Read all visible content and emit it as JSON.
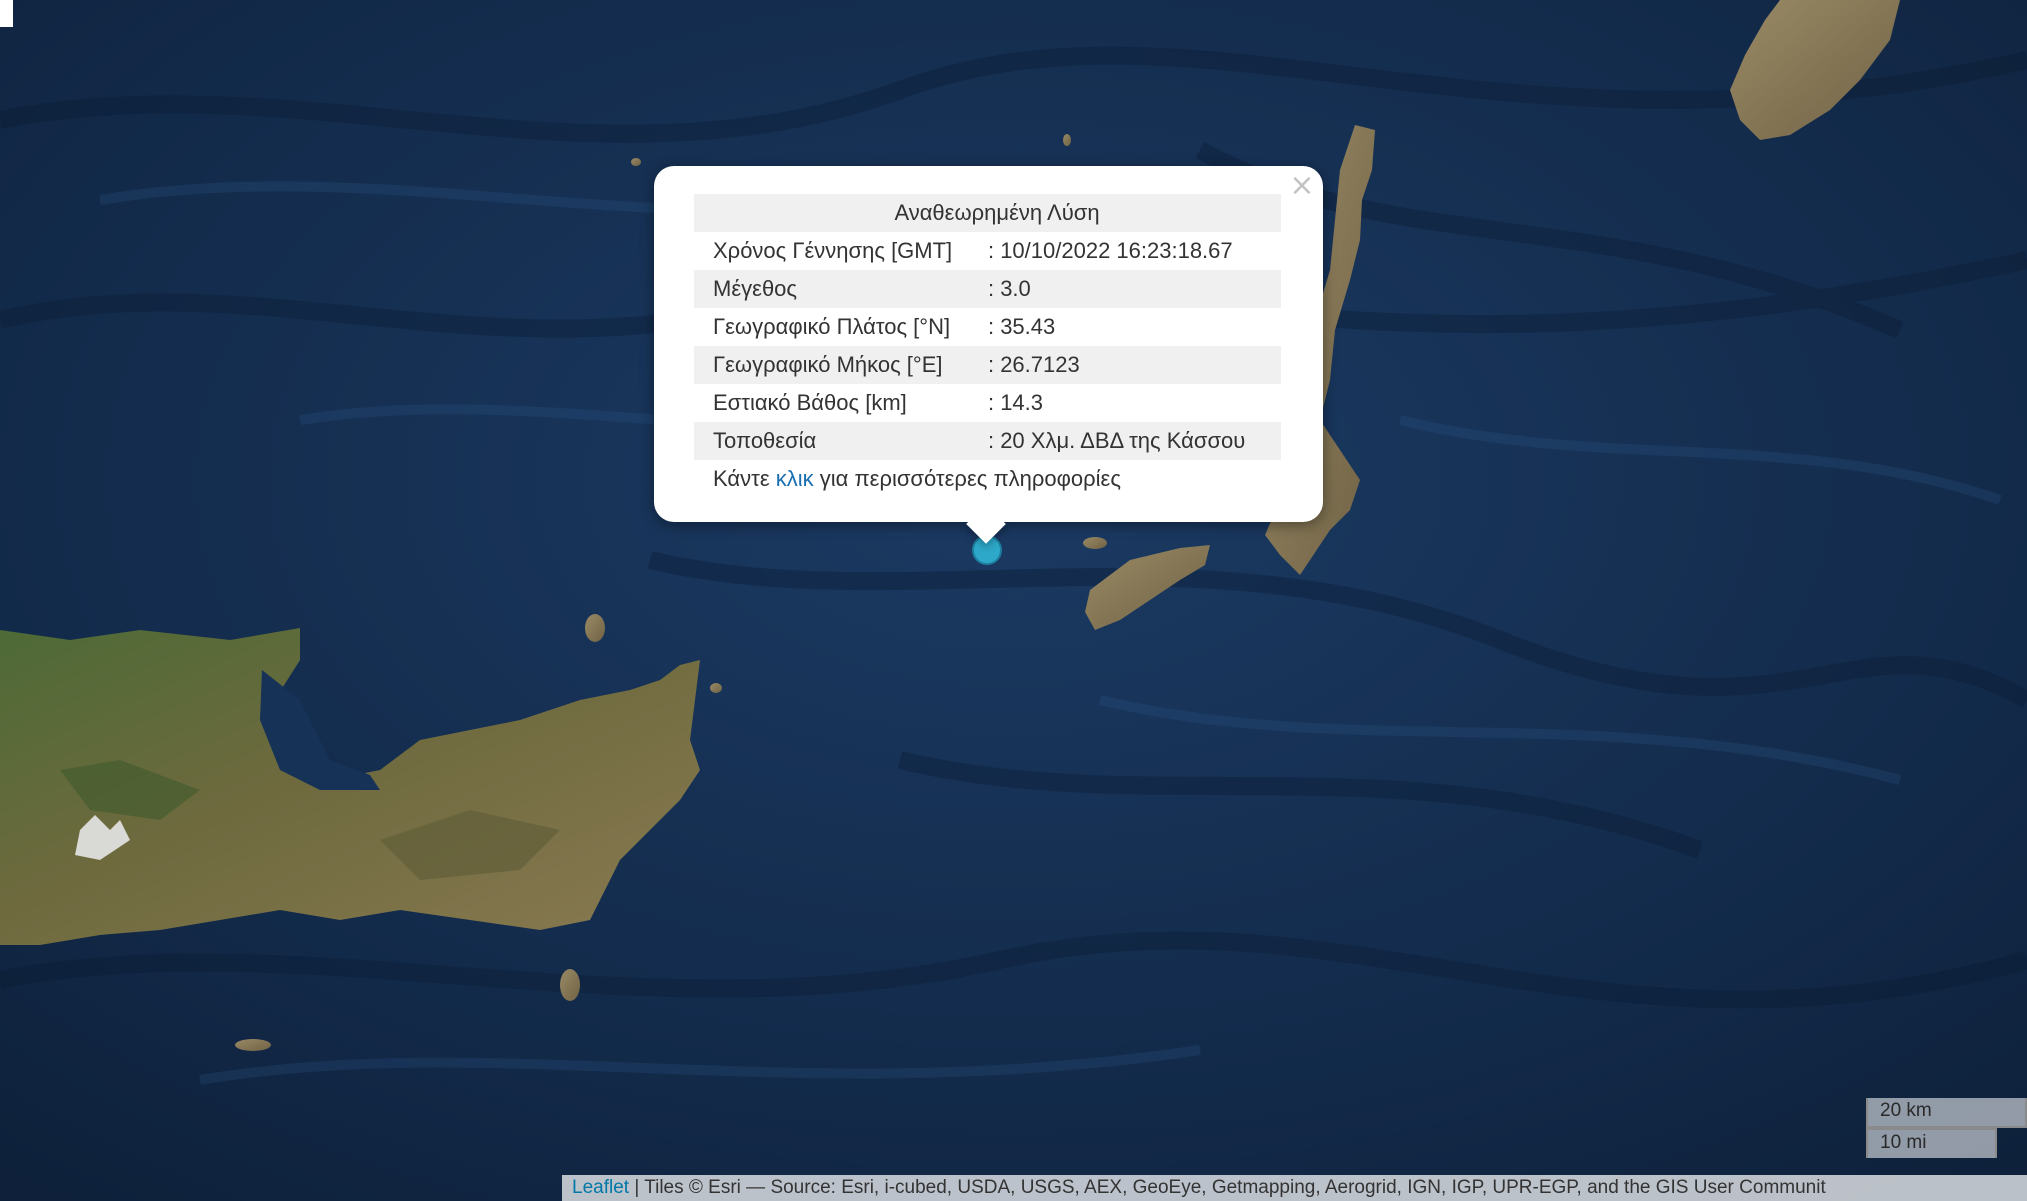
{
  "popup": {
    "title": "Αναθεωρημένη Λύση",
    "close_symbol": "×",
    "rows": [
      {
        "label": "Χρόνος Γέννησης [GMT]",
        "value": ": 10/10/2022 16:23:18.67"
      },
      {
        "label": "Μέγεθος",
        "value": ": 3.0"
      },
      {
        "label": "Γεωγραφικό Πλάτος [°N]",
        "value": ": 35.43"
      },
      {
        "label": "Γεωγραφικό Μήκος [°E]",
        "value": ": 26.7123"
      },
      {
        "label": "Εστιακό Βάθος [km]",
        "value": ": 14.3"
      },
      {
        "label": "Τοποθεσία",
        "value": ": 20 Χλμ. ΔΒΔ της Κάσσου"
      }
    ],
    "footer": {
      "prefix": "Κάντε ",
      "link": "κλικ",
      "suffix": " για περισσότερες πληροφορίες"
    }
  },
  "marker": {
    "name": "earthquake-epicenter",
    "color": "#2ea8c9"
  },
  "scale": {
    "km_label": "20 km",
    "mi_label": "10 mi"
  },
  "attribution": {
    "link": "Leaflet",
    "text": " | Tiles © Esri — Source: Esri, i-cubed, USDA, USGS, AEX, GeoEye, Getmapping, Aerogrid, IGN, IGP, UPR-EGP, and the GIS User Communit"
  },
  "colors": {
    "sea": "#12294a",
    "land": "#5e6b3a",
    "popup_title": "#15931c",
    "link": "#1a6fb0"
  }
}
